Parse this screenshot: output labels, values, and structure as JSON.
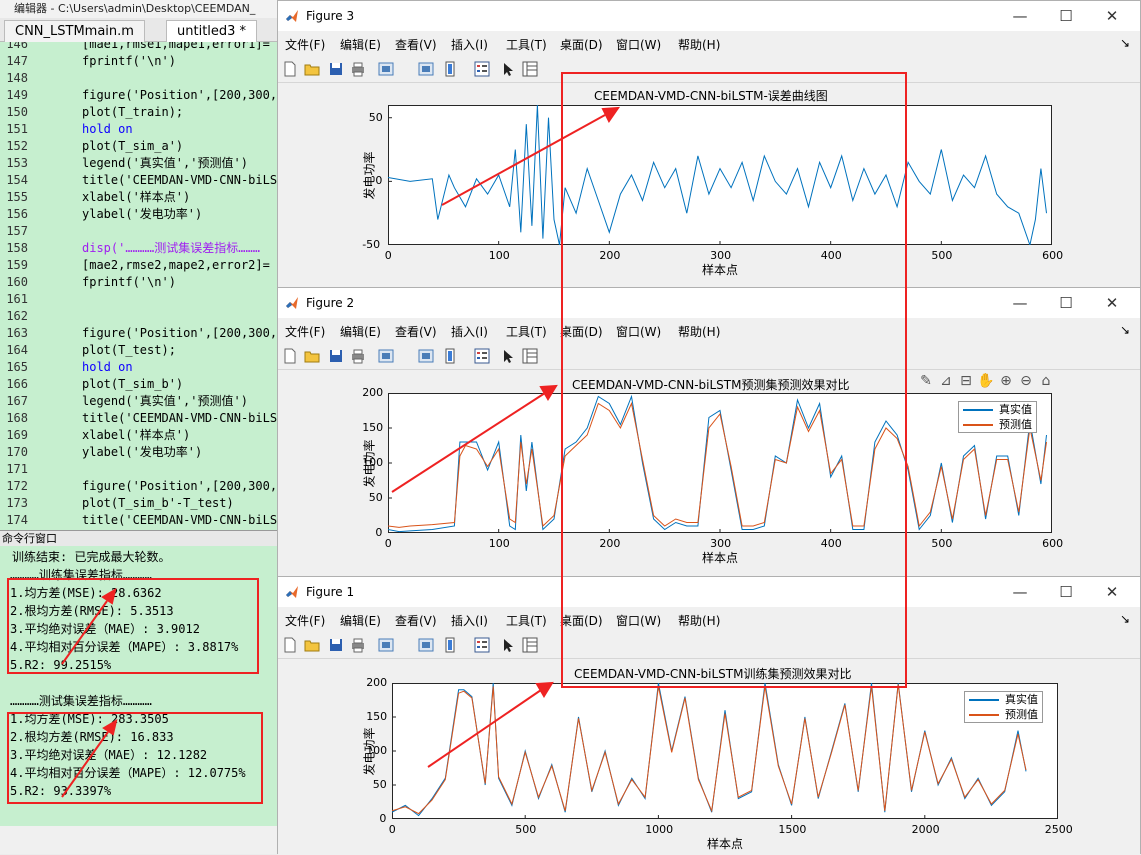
{
  "editor": {
    "title": "编辑器 - C:\\Users\\admin\\Desktop\\CEEMDAN_",
    "tabs": [
      "CNN_LSTMmain.m",
      "untitled3 *"
    ],
    "lines": [
      {
        "n": "146",
        "c": "[mae1,rmse1,mape1,error1]="
      },
      {
        "n": "147",
        "c": "fprintf('\\n')"
      },
      {
        "n": "148",
        "c": ""
      },
      {
        "n": "149",
        "c": "figure('Position',[200,300,"
      },
      {
        "n": "150",
        "c": "plot(T_train);"
      },
      {
        "n": "151",
        "c": "hold on"
      },
      {
        "n": "152",
        "c": "plot(T_sim_a')"
      },
      {
        "n": "153",
        "c": "legend('真实值','预测值')"
      },
      {
        "n": "154",
        "c": "title('CEEMDAN-VMD-CNN-biLS"
      },
      {
        "n": "155",
        "c": "xlabel('样本点')"
      },
      {
        "n": "156",
        "c": "ylabel('发电功率')"
      },
      {
        "n": "157",
        "c": ""
      },
      {
        "n": "158",
        "c": "disp('…………测试集误差指标………"
      },
      {
        "n": "159",
        "c": "[mae2,rmse2,mape2,error2]="
      },
      {
        "n": "160",
        "c": "fprintf('\\n')"
      },
      {
        "n": "161",
        "c": ""
      },
      {
        "n": "162",
        "c": ""
      },
      {
        "n": "163",
        "c": "figure('Position',[200,300,"
      },
      {
        "n": "164",
        "c": "plot(T_test);"
      },
      {
        "n": "165",
        "c": "hold on"
      },
      {
        "n": "166",
        "c": "plot(T_sim_b')"
      },
      {
        "n": "167",
        "c": "legend('真实值','预测值')"
      },
      {
        "n": "168",
        "c": "title('CEEMDAN-VMD-CNN-biLS"
      },
      {
        "n": "169",
        "c": "xlabel('样本点')"
      },
      {
        "n": "170",
        "c": "ylabel('发电功率')"
      },
      {
        "n": "171",
        "c": ""
      },
      {
        "n": "172",
        "c": "figure('Position',[200,300,"
      },
      {
        "n": "173",
        "c": "plot(T_sim_b'-T_test)"
      },
      {
        "n": "174",
        "c": "title('CEEMDAN-VMD-CNN-biLS"
      }
    ]
  },
  "command_window": {
    "header": "命令行窗口",
    "lines": [
      "训练结束: 已完成最大轮数。",
      "…………训练集误差指标…………",
      "1.均方差(MSE): 28.6362",
      "2.根均方差(RMSE): 5.3513",
      "3.平均绝对误差（MAE）: 3.9012",
      "4.平均相对百分误差（MAPE）: 3.8817%",
      "5.R2: 99.2515%",
      "",
      "…………测试集误差指标…………",
      "1.均方差(MSE): 283.3505",
      "2.根均方差(RMSE): 16.833",
      "3.平均绝对误差（MAE）: 12.1282",
      "4.平均相对百分误差（MAPE）: 12.0775%",
      "5.R2: 93.3397%"
    ]
  },
  "menus": [
    "文件(F)",
    "编辑(E)",
    "查看(V)",
    "插入(I)",
    "工具(T)",
    "桌面(D)",
    "窗口(W)",
    "帮助(H)"
  ],
  "window_controls": {
    "minimize": "—",
    "maximize": "☐",
    "close": "✕"
  },
  "figures": [
    {
      "window_title": "Figure 3",
      "chart_data": {
        "type": "line",
        "title": "CEEMDAN-VMD-CNN-biLSTM-误差曲线图",
        "xlabel": "样本点",
        "ylabel": "发电功率",
        "xlim": [
          0,
          600
        ],
        "ylim": [
          -50,
          60
        ],
        "xticks": [
          "0",
          "100",
          "200",
          "300",
          "400",
          "500",
          "600"
        ],
        "yticks": [
          "50",
          "0",
          "-50"
        ],
        "series": [
          {
            "color": "#0072bd",
            "x": [
              0,
              20,
              40,
              45,
              55,
              60,
              70,
              80,
              90,
              100,
              110,
              115,
              120,
              125,
              130,
              135,
              140,
              145,
              150,
              155,
              160,
              170,
              180,
              190,
              200,
              210,
              220,
              230,
              240,
              250,
              260,
              270,
              280,
              290,
              300,
              310,
              320,
              330,
              340,
              350,
              360,
              370,
              380,
              390,
              400,
              410,
              420,
              430,
              440,
              450,
              460,
              470,
              480,
              490,
              500,
              510,
              520,
              530,
              540,
              550,
              560,
              570,
              580,
              585,
              590,
              595
            ],
            "y": [
              3,
              0,
              2,
              -30,
              5,
              -5,
              -20,
              2,
              -10,
              5,
              -20,
              25,
              -40,
              45,
              -35,
              60,
              -45,
              50,
              -30,
              -50,
              -5,
              -25,
              10,
              -15,
              -40,
              -10,
              5,
              -15,
              15,
              -5,
              10,
              -25,
              20,
              -10,
              10,
              -5,
              15,
              -15,
              20,
              0,
              -10,
              10,
              -20,
              15,
              -5,
              20,
              -15,
              10,
              -10,
              5,
              -20,
              15,
              0,
              -10,
              25,
              -15,
              5,
              -5,
              20,
              -10,
              -20,
              -25,
              -50,
              -30,
              10,
              -25
            ]
          }
        ]
      }
    },
    {
      "window_title": "Figure 2",
      "chart_data": {
        "type": "line",
        "title": "CEEMDAN-VMD-CNN-biLSTM预测集预测效果对比",
        "xlabel": "样本点",
        "ylabel": "发电功率",
        "xlim": [
          0,
          600
        ],
        "ylim": [
          0,
          200
        ],
        "xticks": [
          "0",
          "100",
          "200",
          "300",
          "400",
          "500",
          "600"
        ],
        "yticks": [
          "200",
          "150",
          "100",
          "50",
          "0"
        ],
        "legend": [
          "真实值",
          "预测值"
        ],
        "series": [
          {
            "name": "真实值",
            "color": "#0072bd",
            "x": [
              0,
              10,
              20,
              40,
              60,
              65,
              70,
              80,
              90,
              100,
              110,
              115,
              120,
              125,
              130,
              140,
              150,
              160,
              170,
              180,
              190,
              200,
              210,
              220,
              230,
              240,
              250,
              260,
              270,
              280,
              290,
              300,
              310,
              320,
              330,
              340,
              350,
              360,
              370,
              380,
              390,
              400,
              410,
              420,
              430,
              440,
              450,
              460,
              470,
              480,
              490,
              500,
              510,
              520,
              530,
              540,
              550,
              560,
              570,
              580,
              590,
              595
            ],
            "y": [
              5,
              2,
              3,
              5,
              10,
              130,
              130,
              130,
              90,
              130,
              10,
              5,
              140,
              60,
              130,
              5,
              20,
              120,
              130,
              150,
              195,
              185,
              155,
              195,
              100,
              20,
              5,
              15,
              10,
              10,
              165,
              175,
              90,
              5,
              5,
              10,
              110,
              100,
              190,
              150,
              185,
              80,
              110,
              5,
              5,
              130,
              160,
              140,
              90,
              5,
              25,
              100,
              15,
              110,
              125,
              20,
              110,
              110,
              25,
              160,
              70,
              140
            ]
          },
          {
            "name": "预测值",
            "color": "#d95319",
            "x": [
              0,
              10,
              20,
              40,
              60,
              65,
              70,
              80,
              90,
              100,
              110,
              115,
              120,
              125,
              130,
              140,
              150,
              160,
              170,
              180,
              190,
              200,
              210,
              220,
              230,
              240,
              250,
              260,
              270,
              280,
              290,
              300,
              310,
              320,
              330,
              340,
              350,
              360,
              370,
              380,
              390,
              400,
              410,
              420,
              430,
              440,
              450,
              460,
              470,
              480,
              490,
              500,
              510,
              520,
              530,
              540,
              550,
              560,
              570,
              580,
              590,
              595
            ],
            "y": [
              10,
              8,
              10,
              12,
              15,
              110,
              125,
              120,
              95,
              120,
              20,
              15,
              130,
              70,
              120,
              10,
              25,
              110,
              125,
              140,
              185,
              175,
              150,
              185,
              105,
              25,
              10,
              20,
              15,
              15,
              150,
              170,
              95,
              10,
              10,
              15,
              105,
              100,
              180,
              145,
              175,
              85,
              105,
              10,
              10,
              120,
              150,
              135,
              95,
              10,
              30,
              95,
              20,
              105,
              120,
              25,
              105,
              105,
              30,
              150,
              75,
              130
            ]
          }
        ]
      }
    },
    {
      "window_title": "Figure 1",
      "chart_data": {
        "type": "line",
        "title": "CEEMDAN-VMD-CNN-biLSTM训练集预测效果对比",
        "xlabel": "样本点",
        "ylabel": "发电功率",
        "xlim": [
          0,
          2500
        ],
        "ylim": [
          0,
          200
        ],
        "xticks": [
          "0",
          "500",
          "1000",
          "1500",
          "2000",
          "2500"
        ],
        "yticks": [
          "200",
          "150",
          "100",
          "50",
          "0"
        ],
        "legend": [
          "真实值",
          "预测值"
        ],
        "series": [
          {
            "name": "真实值",
            "color": "#0072bd",
            "x": [
              0,
              50,
              100,
              150,
              200,
              250,
              270,
              300,
              350,
              380,
              400,
              450,
              500,
              550,
              600,
              650,
              700,
              750,
              800,
              850,
              900,
              950,
              1000,
              1050,
              1100,
              1150,
              1200,
              1250,
              1300,
              1350,
              1400,
              1450,
              1500,
              1550,
              1600,
              1650,
              1700,
              1750,
              1800,
              1850,
              1900,
              1950,
              2000,
              2050,
              2100,
              2150,
              2200,
              2250,
              2300,
              2350,
              2380
            ],
            "y": [
              10,
              20,
              5,
              30,
              60,
              190,
              190,
              180,
              50,
              200,
              60,
              20,
              100,
              30,
              80,
              10,
              150,
              40,
              100,
              20,
              60,
              30,
              200,
              100,
              180,
              60,
              10,
              160,
              30,
              40,
              200,
              80,
              20,
              150,
              30,
              100,
              170,
              40,
              200,
              10,
              200,
              40,
              130,
              50,
              90,
              30,
              60,
              20,
              40,
              130,
              70
            ]
          },
          {
            "name": "预测值",
            "color": "#d95319",
            "x": [
              0,
              50,
              100,
              150,
              200,
              250,
              270,
              300,
              350,
              380,
              400,
              450,
              500,
              550,
              600,
              650,
              700,
              750,
              800,
              850,
              900,
              950,
              1000,
              1050,
              1100,
              1150,
              1200,
              1250,
              1300,
              1350,
              1400,
              1450,
              1500,
              1550,
              1600,
              1650,
              1700,
              1750,
              1800,
              1850,
              1900,
              1950,
              2000,
              2050,
              2100,
              2150,
              2200,
              2250,
              2300,
              2350,
              2380
            ],
            "y": [
              12,
              18,
              8,
              28,
              58,
              185,
              188,
              178,
              52,
              195,
              62,
              22,
              98,
              32,
              78,
              12,
              148,
              42,
              98,
              22,
              58,
              32,
              195,
              98,
              178,
              58,
              12,
              155,
              32,
              42,
              195,
              78,
              22,
              148,
              32,
              98,
              168,
              42,
              195,
              12,
              198,
              42,
              128,
              52,
              88,
              32,
              58,
              22,
              42,
              125,
              72
            ]
          }
        ]
      }
    }
  ]
}
